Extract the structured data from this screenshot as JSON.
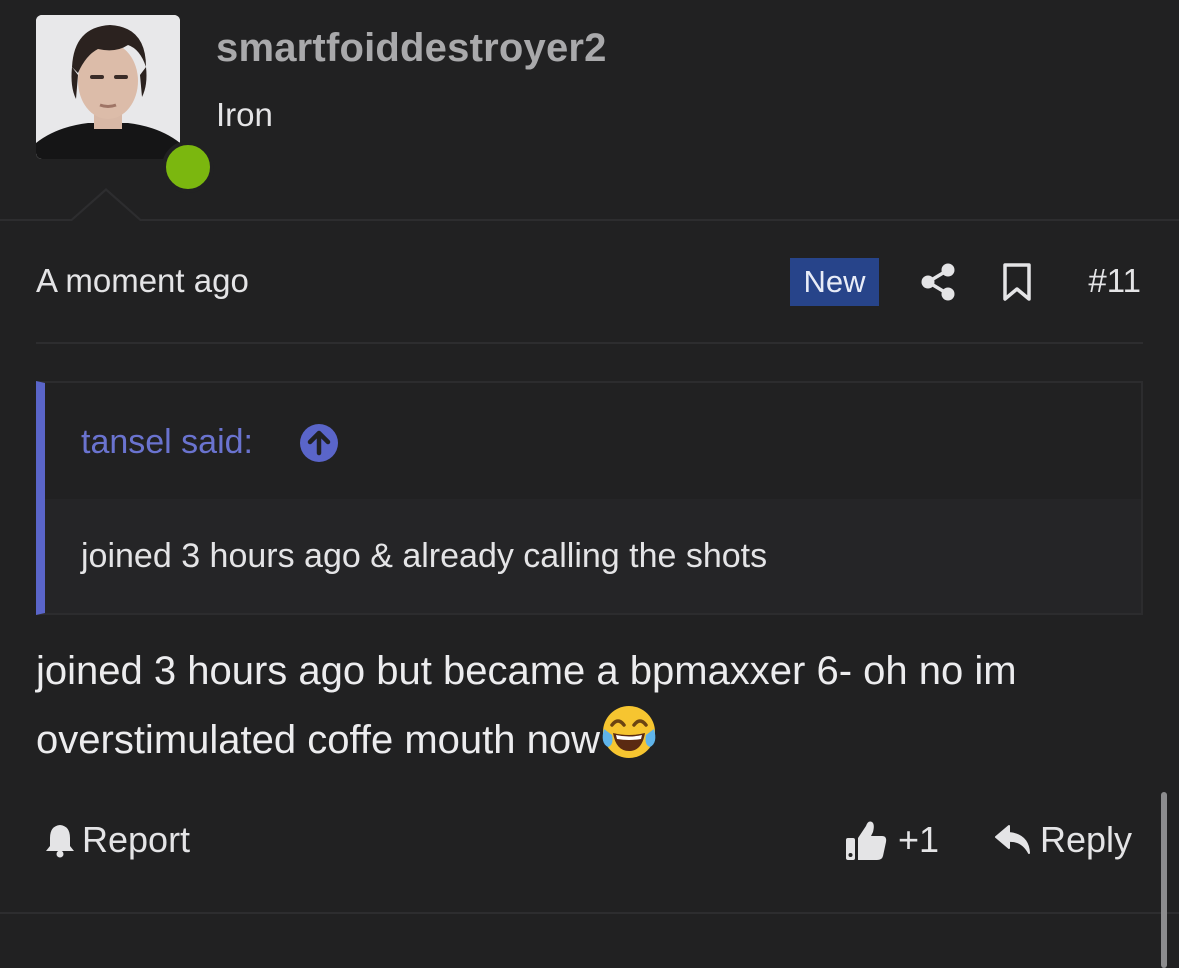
{
  "user": {
    "username": "smartfoiddestroyer2",
    "rank": "Iron",
    "online_color": "#7bb70f"
  },
  "post": {
    "timestamp": "A moment ago",
    "badge": "New",
    "number": "#11",
    "share_icon": "share-icon",
    "bookmark_icon": "bookmark-icon"
  },
  "quote": {
    "author_label": "tansel said:",
    "text": "joined 3 hours ago & already calling the shots",
    "accent_color": "#5a65c9"
  },
  "message": {
    "text": "joined 3 hours ago but became a bpmaxxer 6- oh no im overstimulated coffe mouth now",
    "emoji": "face-with-tears-of-joy"
  },
  "actions": {
    "report_label": "Report",
    "like_count": "+1",
    "reply_label": "Reply"
  }
}
